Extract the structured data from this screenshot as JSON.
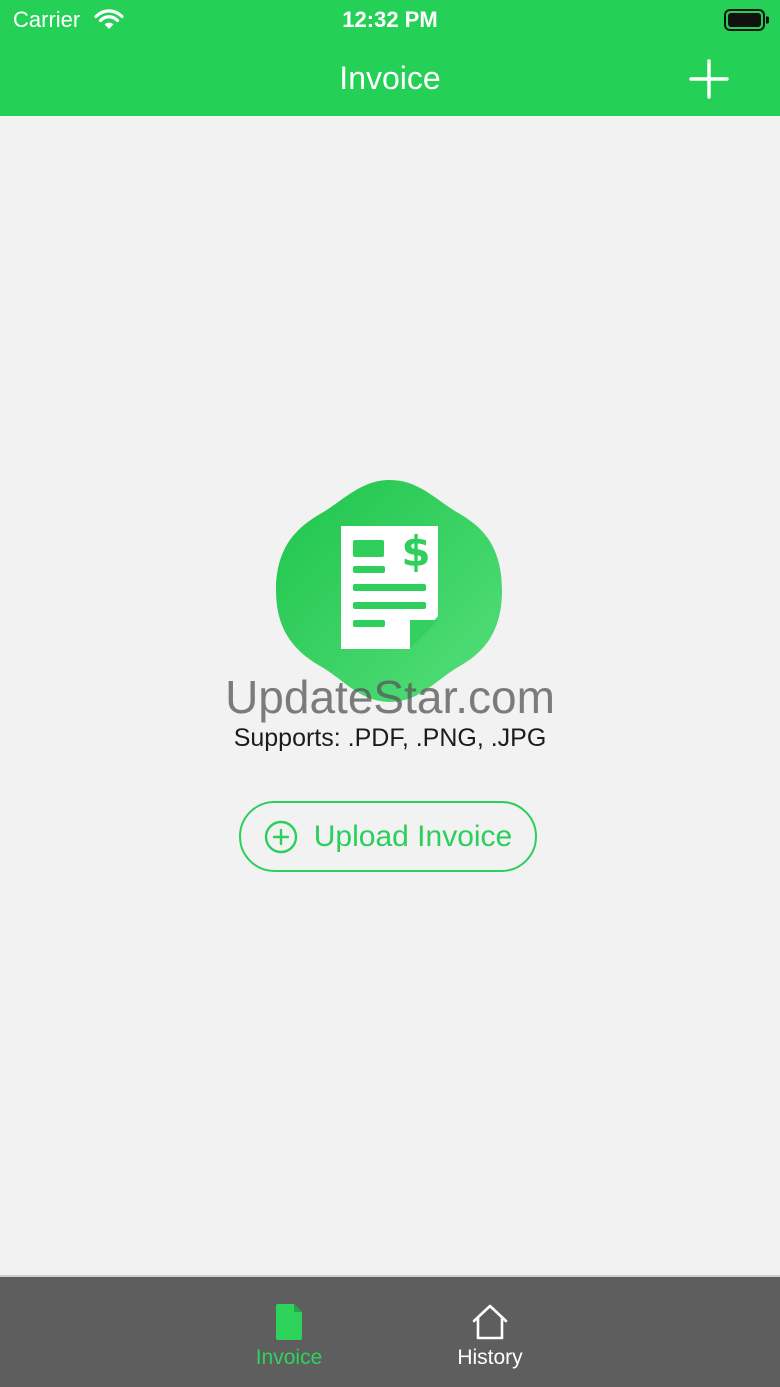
{
  "status_bar": {
    "carrier": "Carrier",
    "time": "12:32 PM",
    "icons": [
      "wifi-icon",
      "battery-icon"
    ]
  },
  "nav": {
    "title": "Invoice",
    "add_icon": "plus-icon"
  },
  "main": {
    "hero_icon": "invoice-dollar-badge-icon",
    "watermark": "UpdateStar.com",
    "supports_text": "Supports: .PDF, .PNG, .JPG",
    "upload_label": "Upload Invoice",
    "upload_icon": "plus-circle-icon"
  },
  "tabbar": {
    "tabs": [
      {
        "label": "Invoice",
        "icon": "document-icon",
        "active": true
      },
      {
        "label": "History",
        "icon": "home-icon",
        "active": false
      }
    ]
  },
  "colors": {
    "accent": "#25d056",
    "background": "#f2f2f2",
    "tabbar": "#5e5e5e",
    "active_tab": "#2ed35c",
    "inactive_tab": "#ffffff"
  }
}
